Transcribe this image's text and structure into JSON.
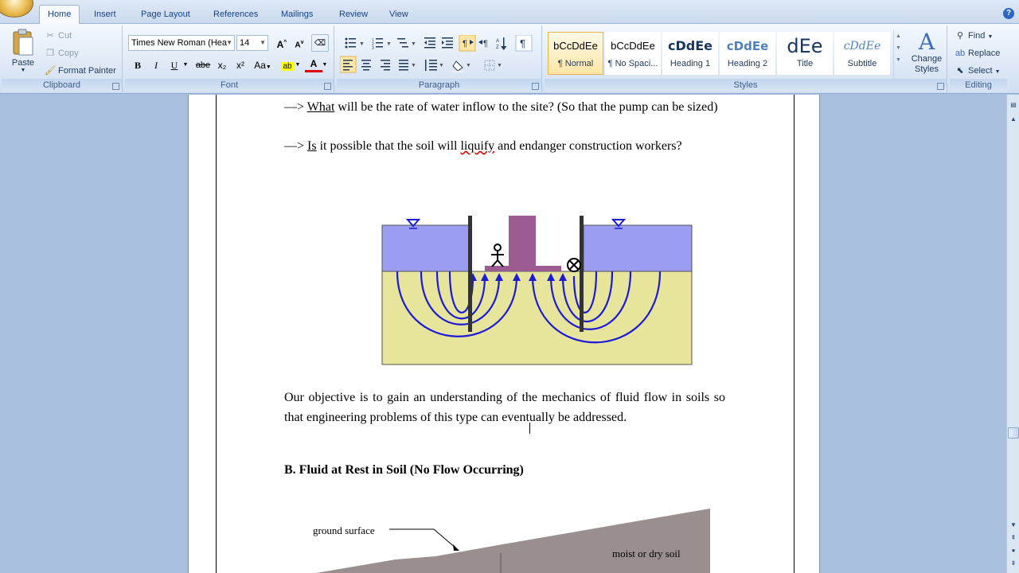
{
  "tabs": [
    {
      "label": "Home",
      "active": true
    },
    {
      "label": "Insert"
    },
    {
      "label": "Page Layout"
    },
    {
      "label": "References"
    },
    {
      "label": "Mailings"
    },
    {
      "label": "Review"
    },
    {
      "label": "View"
    }
  ],
  "clipboard": {
    "group_label": "Clipboard",
    "paste": "Paste",
    "cut": "Cut",
    "copy": "Copy",
    "format_painter": "Format Painter"
  },
  "font": {
    "group_label": "Font",
    "font_name": "Times New Roman (Hea",
    "font_size": "14",
    "bold": "B",
    "italic": "I",
    "underline": "U",
    "strike": "abe",
    "subscript": "x₂",
    "superscript": "x²",
    "change_case": "Aa",
    "grow": "A",
    "shrink": "A",
    "font_color_glyph": "A"
  },
  "paragraph": {
    "group_label": "Paragraph"
  },
  "styles": {
    "group_label": "Styles",
    "items": [
      {
        "preview": "bCcDdEe",
        "name": "¶ Normal",
        "selected": true
      },
      {
        "preview": "bCcDdEe",
        "name": "¶ No Spaci..."
      },
      {
        "preview": "cDdEe",
        "name": "Heading 1"
      },
      {
        "preview": "cDdEe",
        "name": "Heading 2"
      },
      {
        "preview": "dEe",
        "name": "Title"
      },
      {
        "preview": "cDdEe",
        "name": "Subtitle"
      }
    ],
    "change_styles": "Change Styles"
  },
  "editing": {
    "group_label": "Editing",
    "find": "Find",
    "replace": "Replace",
    "select": "Select"
  },
  "document": {
    "line1_prefix": "—> ",
    "line1_what": "What",
    "line1_rest": " will be the rate of water inflow to the site? (So that the pump can be sized)",
    "line2_prefix": "—> ",
    "line2_is": "Is",
    "line2_mid": " it possible that the soil will ",
    "line2_liquify": "liquify",
    "line2_rest": " and endanger construction workers?",
    "objective": "Our objective is to gain an understanding of the mechanics of fluid flow in soils so that engineering problems of this type can eventually be addressed.",
    "section_heading": "B. Fluid at Rest in Soil (No Flow Occurring)",
    "fig2_ground_label": "ground surface",
    "fig2_soil_label": "moist or dry soil"
  },
  "colors": {
    "water": "#9a9df0",
    "soil": "#e7e59c",
    "structure": "#9a5c91",
    "flowline": "#1a1ad8",
    "ribbon_text": "#1e395b"
  }
}
